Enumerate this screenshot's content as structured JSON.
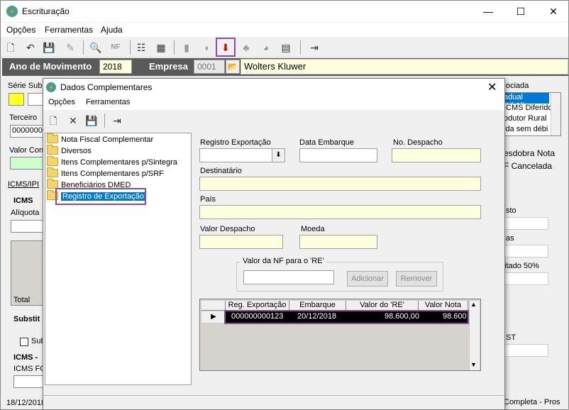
{
  "app": {
    "title": "Escrituração",
    "menu": [
      "Opções",
      "Ferramentas",
      "Ajuda"
    ]
  },
  "header": {
    "ano_label": "Ano de Movimento",
    "ano_value": "2018",
    "empresa_label": "Empresa",
    "empresa_code": "0001",
    "empresa_name": "Wolters Kluwer"
  },
  "background": {
    "serie_label": "Série Sub",
    "terceiro_label": "Terceiro",
    "terceiro_value": "0000000",
    "valor_cont_label": "Valor Cont",
    "tab_label": "ICMS/IPI",
    "icms_title": "ICMS",
    "aliquota_label": "Alíquota",
    "total_label": "Total",
    "subst_title": "Substit",
    "sub_label": "Sub",
    "icms2_title": "ICMS -",
    "icms_fc_label": "ICMS FC",
    "date_status": "18/12/2018",
    "right_header": "ociada",
    "right_items": [
      "adual Dif.Alíq",
      "ICMS Diferido",
      "odutor Rural",
      "ida sem débi"
    ],
    "desdobra": "esdobra Nota",
    "cancelada": "F Cancelada",
    "sto": "sto",
    "as": "as",
    "itado": "itado 50%",
    "st": "ST",
    "completa": "Completa - Pros"
  },
  "dialog": {
    "title": "Dados Complementares",
    "menu": [
      "Opções",
      "Ferramentas"
    ],
    "tree": [
      "Nota Fiscal Complementar",
      "Diversos",
      "Itens Complementares p/Sintegra",
      "Itens Complementares p/SRF",
      "Beneficiários DMED",
      "Registro de Exportação"
    ],
    "form": {
      "registro_label": "Registro Exportação",
      "data_embarque_label": "Data Embarque",
      "no_despacho_label": "No. Despacho",
      "destinatario_label": "Destinatário",
      "pais_label": "País",
      "valor_despacho_label": "Valor Despacho",
      "moeda_label": "Moeda",
      "valor_nf_group": "Valor da NF para o 'RE'",
      "adicionar": "Adicionar",
      "remover": "Remover"
    },
    "grid": {
      "columns": [
        "Reg. Exportação",
        "Embarque",
        "Valor do 'RE'",
        "Valor Nota"
      ],
      "rows": [
        {
          "reg": "000000000123",
          "embarque": "20/12/2018",
          "valor_re": "98.600,00",
          "valor_nota": "98.600"
        }
      ]
    }
  }
}
